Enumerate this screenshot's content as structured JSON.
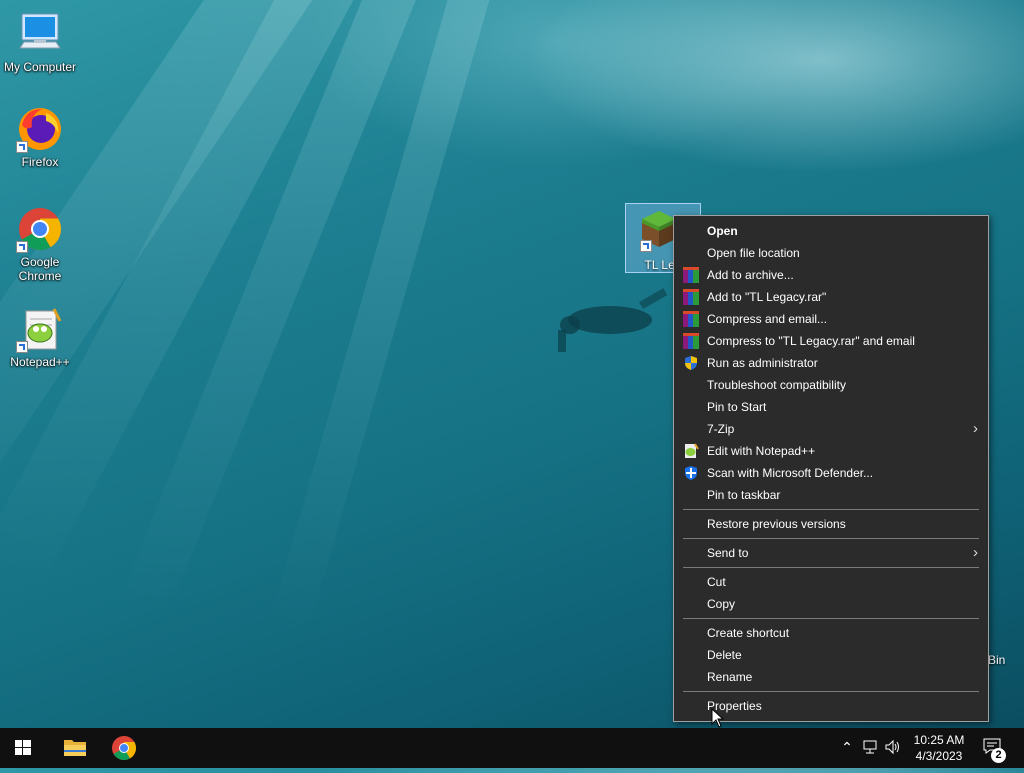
{
  "desktop": {
    "icons": [
      {
        "label": "My Computer"
      },
      {
        "label": "Firefox"
      },
      {
        "label": "Google Chrome"
      },
      {
        "label": "Notepad++"
      }
    ],
    "selected_file": {
      "label": "TL Leg"
    },
    "recycle_bin_partial_label": "Bin"
  },
  "context_menu": {
    "items": [
      {
        "label": "Open",
        "icon": ""
      },
      {
        "label": "Open file location",
        "icon": ""
      },
      {
        "label": "Add to archive...",
        "icon": "winrar-icon"
      },
      {
        "label": "Add to \"TL Legacy.rar\"",
        "icon": "winrar-icon"
      },
      {
        "label": "Compress and email...",
        "icon": "winrar-icon"
      },
      {
        "label": "Compress to \"TL Legacy.rar\" and email",
        "icon": "winrar-icon"
      },
      {
        "label": "Run as administrator",
        "icon": "uac-shield-icon"
      },
      {
        "label": "Troubleshoot compatibility",
        "icon": ""
      },
      {
        "label": "Pin to Start",
        "icon": ""
      },
      {
        "label": "7-Zip",
        "icon": ""
      },
      {
        "label": "Edit with Notepad++",
        "icon": "notepadpp-icon"
      },
      {
        "label": "Scan with Microsoft Defender...",
        "icon": "defender-icon"
      },
      {
        "label": "Pin to taskbar",
        "icon": ""
      },
      {
        "label": "Restore previous versions",
        "icon": ""
      },
      {
        "label": "Send to",
        "icon": ""
      },
      {
        "label": "Cut",
        "icon": ""
      },
      {
        "label": "Copy",
        "icon": ""
      },
      {
        "label": "Create shortcut",
        "icon": ""
      },
      {
        "label": "Delete",
        "icon": ""
      },
      {
        "label": "Rename",
        "icon": ""
      },
      {
        "label": "Properties",
        "icon": ""
      }
    ]
  },
  "taskbar": {
    "time": "10:25 AM",
    "date": "4/3/2023",
    "notification_count": "2"
  },
  "colors": {
    "menu_bg": "#2b2b2b",
    "taskbar_bg": "#101010",
    "accent_blue": "#00a2ed"
  }
}
